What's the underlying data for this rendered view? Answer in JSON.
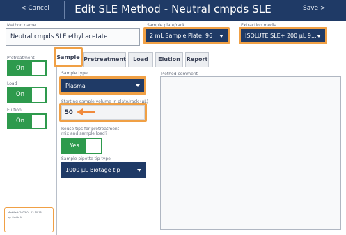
{
  "header": {
    "cancel_label": "< Cancel",
    "title": "Edit SLE Method - Neutral cmpds SLE",
    "save_label": "Save >"
  },
  "method": {
    "name_label": "Method name",
    "name_value": "Neutral cmpds SLE ethyl acetate",
    "plate_label": "Sample plate/rack",
    "plate_value": "2 mL Sample Plate, 96",
    "media_label": "Extraction media",
    "media_value": "ISOLUTE SLE+ 200 µL 9..."
  },
  "sidebar": {
    "toggles": [
      {
        "label": "Pretreatment",
        "value": "On"
      },
      {
        "label": "Load",
        "value": "On"
      },
      {
        "label": "Elution",
        "value": "On"
      }
    ],
    "modified_text": "Modified: 2023-01-12 10:15",
    "modified_by": "by: Smith A"
  },
  "tabs": [
    {
      "label": "Sample",
      "active": true
    },
    {
      "label": "Pretreatment",
      "active": false
    },
    {
      "label": "Load",
      "active": false
    },
    {
      "label": "Elution",
      "active": false
    },
    {
      "label": "Report",
      "active": false
    }
  ],
  "sample": {
    "type_label": "Sample type",
    "type_value": "Plasma",
    "volume_label": "Starting sample volume in plate/rack (µL)",
    "volume_value": "50",
    "reuse_label_1": "Reuse tips for pretreatment",
    "reuse_label_2": "mix and sample load?",
    "reuse_value": "Yes",
    "tip_label": "Sample pipette tip type",
    "tip_value": "1000 µL Biotage tip"
  },
  "comment": {
    "label": "Method comment",
    "value": ""
  },
  "colors": {
    "primary": "#1f3a66",
    "highlight": "#f0a045",
    "toggle_on": "#2e9a4d"
  }
}
